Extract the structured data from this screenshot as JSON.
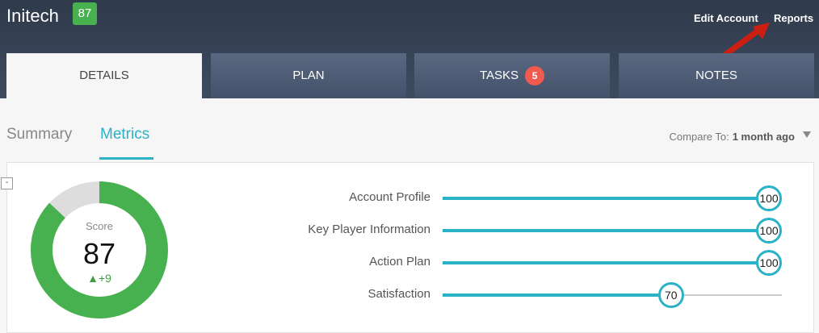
{
  "header": {
    "company": "Initech",
    "score_badge": "87",
    "links": {
      "edit_account": "Edit Account",
      "reports": "Reports"
    }
  },
  "tabs": [
    {
      "label": "DETAILS",
      "active": true
    },
    {
      "label": "PLAN"
    },
    {
      "label": "TASKS",
      "badge": "5"
    },
    {
      "label": "NOTES"
    }
  ],
  "subtabs": {
    "summary": "Summary",
    "metrics": "Metrics"
  },
  "compare": {
    "label": "Compare To:",
    "value": "1 month ago"
  },
  "collapse_glyph": "-",
  "score": {
    "label": "Score",
    "value": "87",
    "change": "+9",
    "change_arrow": "▲",
    "fraction": 0.87
  },
  "metrics": [
    {
      "label": "Account Profile",
      "value": "100",
      "fraction": 1.0
    },
    {
      "label": "Key Player Information",
      "value": "100",
      "fraction": 1.0
    },
    {
      "label": "Action Plan",
      "value": "100",
      "fraction": 1.0
    },
    {
      "label": "Satisfaction",
      "value": "70",
      "fraction": 0.7
    }
  ],
  "colors": {
    "accent": "#2bb2c6",
    "green": "#48b14f",
    "badge_red": "#f05a4f",
    "header": "#3b4659"
  }
}
